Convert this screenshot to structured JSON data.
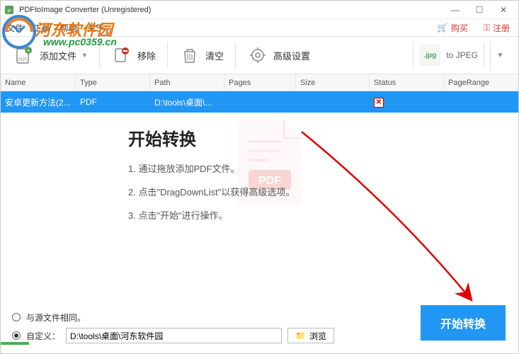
{
  "titlebar": {
    "title": "PDFtoImage Converter (Unregistered)"
  },
  "menubar": {
    "items": [
      "文件",
      "工具",
      "帮助",
      "关于..."
    ],
    "buy": "购买",
    "register": "注册"
  },
  "toolbar": {
    "add": "添加文件",
    "remove": "移除",
    "clear": "清空",
    "settings": "高级设置",
    "format_badge": ".jpg",
    "format_label": "to JPEG"
  },
  "table": {
    "headers": {
      "name": "Name",
      "type": "Type",
      "path": "Path",
      "pages": "Pages",
      "size": "Size",
      "status": "Status",
      "range": "PageRange"
    },
    "rows": [
      {
        "name": "安卓更新方法(2...",
        "type": "PDF",
        "path": "D:\\tools\\桌面\\...",
        "pages": "",
        "size": "",
        "status": "x",
        "range": ""
      }
    ]
  },
  "center": {
    "title": "开始转换",
    "steps": [
      "1. 通过拖放添加PDF文件。",
      "2. 点击\"DragDownList\"以获得高级选项。",
      "3. 点击\"开始\"进行操作。"
    ]
  },
  "bottom": {
    "same_as_source": "与源文件相同。",
    "custom": "自定义：",
    "path_value": "D:\\tools\\桌面\\河东软件园",
    "browse": "浏览",
    "convert": "开始转换"
  },
  "watermark": {
    "site_name": "河东软件园",
    "url": "www.pc0359.cn"
  }
}
